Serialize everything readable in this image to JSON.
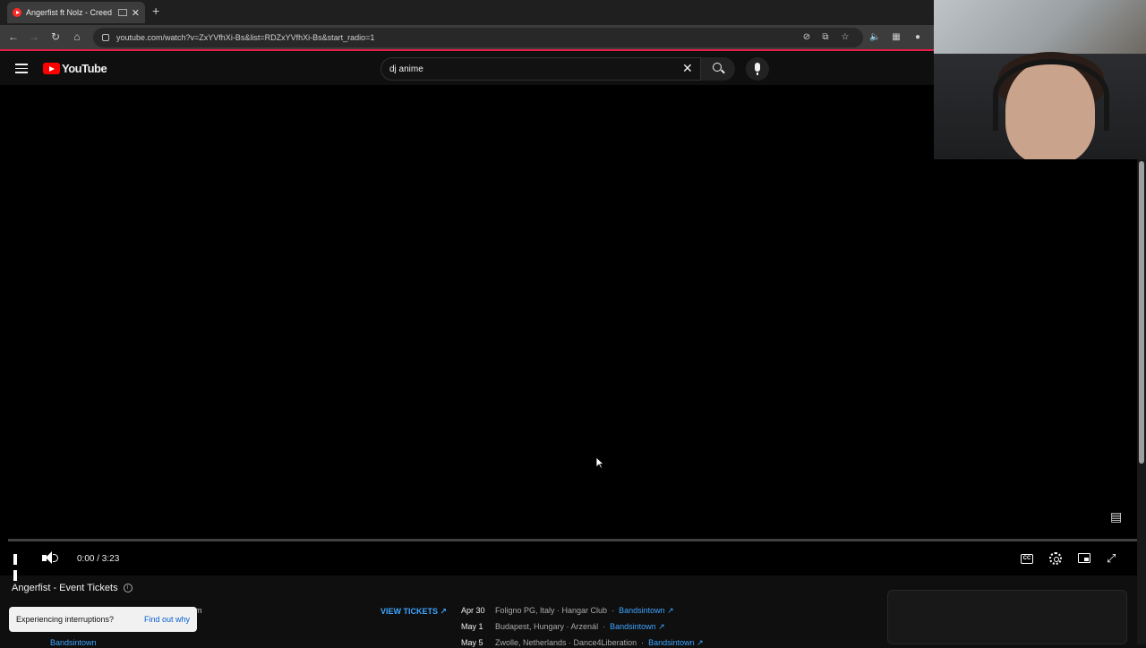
{
  "browser": {
    "tab_title": "Angerfist ft Nolz - Creed Of",
    "new_tab_symbol": "+",
    "url": "youtube.com/watch?v=ZxYVfhXi-Bs&list=RDZxYVfhXi-Bs&start_radio=1",
    "accent": "#e11d48"
  },
  "youtube": {
    "logo_text": "YouTube",
    "search_value": "dj anime",
    "brand_color": "#ff0000"
  },
  "player": {
    "time_display": "0:00 / 3:23",
    "progress_fraction": 0.0
  },
  "tickets": {
    "title": "Angerfist - Event Tickets",
    "view_tickets_label": "VIEW TICKETS ↗",
    "toast_message": "Experiencing interruptions?",
    "toast_link": "Find out why",
    "behind_text": "m",
    "behind_link": "Bandsintown",
    "events": [
      {
        "date": "Apr 30",
        "venue": "Foligno PG, Italy · Hangar Club",
        "link": "Bandsintown ↗"
      },
      {
        "date": "May 1",
        "venue": "Budapest, Hungary · Arzenál",
        "link": "Bandsintown ↗"
      },
      {
        "date": "May 5",
        "venue": "Zwolle, Netherlands · Dance4Liberation",
        "link": "Bandsintown ↗"
      }
    ]
  },
  "icons": [
    "hamburger-icon",
    "search-icon",
    "mic-icon",
    "close-icon",
    "pause-icon",
    "volume-icon",
    "captions-icon",
    "settings-icon",
    "miniplayer-icon",
    "fullscreen-icon",
    "info-icon"
  ]
}
